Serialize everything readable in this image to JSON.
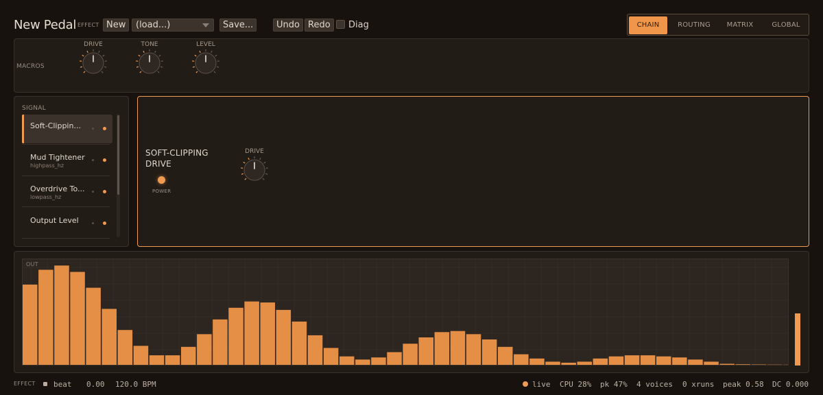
{
  "header": {
    "title": "New Pedal",
    "effect_label": "EFFECT",
    "new_label": "New",
    "load_value": "(load...)",
    "save_label": "Save...",
    "undo_label": "Undo",
    "redo_label": "Redo",
    "diag_label": "Diag",
    "diag_checked": false
  },
  "tabs": [
    {
      "label": "CHAIN",
      "active": true
    },
    {
      "label": "ROUTING",
      "active": false
    },
    {
      "label": "MATRIX",
      "active": false
    },
    {
      "label": "GLOBAL",
      "active": false
    }
  ],
  "macros": {
    "label": "MACROS",
    "knobs": [
      {
        "label": "DRIVE"
      },
      {
        "label": "TONE"
      },
      {
        "label": "LEVEL"
      }
    ]
  },
  "signal": {
    "label": "SIGNAL",
    "items": [
      {
        "name": "Soft-Clippin...",
        "sub": "",
        "active": true
      },
      {
        "name": "Mud Tightener",
        "sub": "highpass_hz",
        "active": false
      },
      {
        "name": "Overdrive To...",
        "sub": "lowpass_hz",
        "active": false
      },
      {
        "name": "Output Level",
        "sub": "",
        "active": false
      }
    ]
  },
  "detail": {
    "title_line1": "SOFT-CLIPPING",
    "title_line2": "DRIVE",
    "power_label": "POWER",
    "knob_label": "DRIVE"
  },
  "output": {
    "label": "OUT",
    "level": 0.49
  },
  "colors": {
    "accent": "#f09a52",
    "bar": "#e58e45",
    "bg": "#17120e",
    "panel": "#221c17"
  },
  "chart_data": {
    "type": "bar",
    "title": "OUT",
    "xlabel": "",
    "ylabel": "",
    "ylim": [
      0,
      1
    ],
    "values": [
      0.76,
      0.9,
      0.94,
      0.88,
      0.73,
      0.53,
      0.33,
      0.18,
      0.09,
      0.09,
      0.17,
      0.29,
      0.43,
      0.54,
      0.6,
      0.59,
      0.52,
      0.41,
      0.28,
      0.16,
      0.08,
      0.05,
      0.07,
      0.12,
      0.2,
      0.26,
      0.31,
      0.32,
      0.29,
      0.24,
      0.17,
      0.1,
      0.06,
      0.03,
      0.02,
      0.03,
      0.06,
      0.08,
      0.09,
      0.09,
      0.08,
      0.07,
      0.05,
      0.03,
      0.01,
      0.005,
      0.003,
      0.002,
      0.001
    ]
  },
  "status": {
    "effect_label": "EFFECT",
    "beat_label": "beat",
    "beat_value": "0.00",
    "bpm": "120.0 BPM",
    "live": "live",
    "cpu": "CPU 28%",
    "pk": "pk 47%",
    "voices": "4 voices",
    "xruns": "0 xruns",
    "peak": "peak 0.58",
    "dc": "DC 0.000"
  }
}
